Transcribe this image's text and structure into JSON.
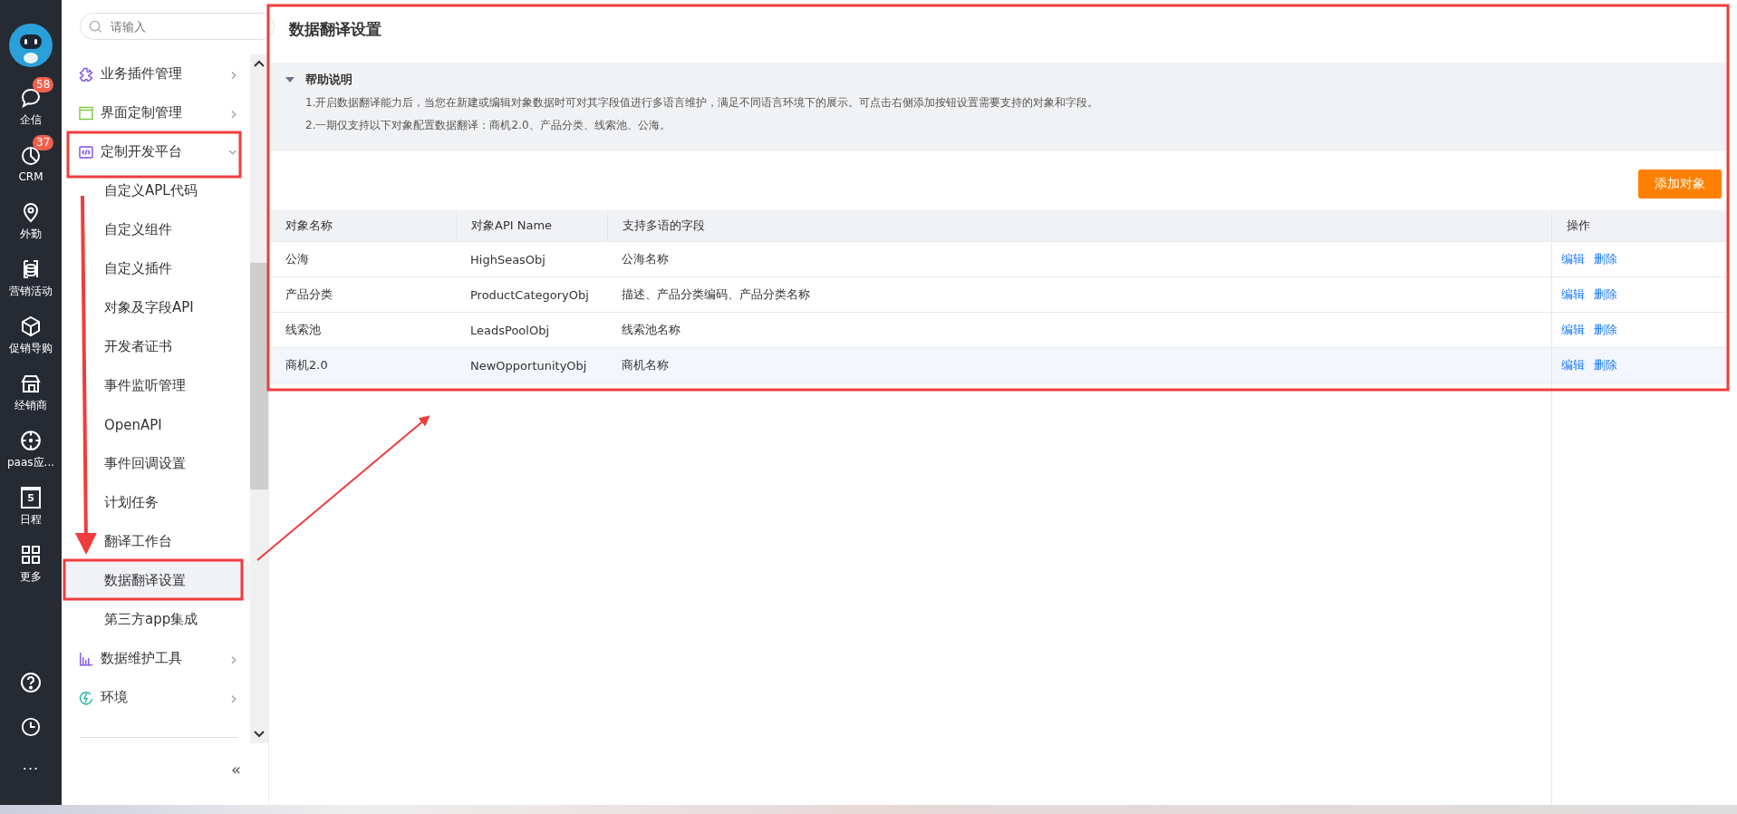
{
  "rail": [
    {
      "label": "企信",
      "badge": "58"
    },
    {
      "label": "CRM",
      "badge": "37"
    },
    {
      "label": "外勤"
    },
    {
      "label": "营销活动"
    },
    {
      "label": "促销导购"
    },
    {
      "label": "经销商"
    },
    {
      "label": "paas应..."
    },
    {
      "label": "日程",
      "icon_text": "5"
    },
    {
      "label": "更多"
    }
  ],
  "rail_bottom_more": "···",
  "sidebar": {
    "search": {
      "placeholder": "请输入"
    },
    "items": [
      {
        "label": "业务插件管理",
        "expanded": false,
        "chevron": "›"
      },
      {
        "label": "界面定制管理",
        "expanded": false,
        "chevron": "›"
      },
      {
        "label": "定制开发平台",
        "expanded": true,
        "chevron": "›",
        "children": [
          {
            "label": "自定义APL代码",
            "selected": false
          },
          {
            "label": "自定义组件",
            "selected": false
          },
          {
            "label": "自定义插件",
            "selected": false
          },
          {
            "label": "对象及字段API",
            "selected": false
          },
          {
            "label": "开发者证书",
            "selected": false
          },
          {
            "label": "事件监听管理",
            "selected": false
          },
          {
            "label": "OpenAPI",
            "selected": false
          },
          {
            "label": "事件回调设置",
            "selected": false
          },
          {
            "label": "计划任务",
            "selected": false
          },
          {
            "label": "翻译工作台",
            "selected": false
          },
          {
            "label": "数据翻译设置",
            "selected": true
          },
          {
            "label": "第三方app集成",
            "selected": false
          }
        ]
      },
      {
        "label": "数据维护工具",
        "expanded": false,
        "chevron": "›"
      },
      {
        "label": "环境",
        "expanded": false,
        "chevron": "›"
      }
    ],
    "collapse": "«"
  },
  "page": {
    "title": "数据翻译设置",
    "help": {
      "title": "帮助说明",
      "expanded": true,
      "lines": [
        "1.开启数据翻译能力后，当您在新建或编辑对象数据时可对其字段值进行多语言维护，满足不同语言环境下的展示。可点击右侧添加按钮设置需要支持的对象和字段。",
        "2.一期仅支持以下对象配置数据翻译：商机2.0、产品分类、线索池、公海。"
      ]
    },
    "add_button": "添加对象",
    "table": {
      "columns": [
        "对象名称",
        "对象API Name",
        "支持多语的字段",
        "操作"
      ],
      "rows": [
        {
          "cells": [
            "公海",
            "HighSeasObj",
            "公海名称"
          ],
          "actions": [
            "编辑",
            "删除"
          ],
          "highlighted": false
        },
        {
          "cells": [
            "产品分类",
            "ProductCategoryObj",
            "描述、产品分类编码、产品分类名称"
          ],
          "actions": [
            "编辑",
            "删除"
          ],
          "highlighted": false
        },
        {
          "cells": [
            "线索池",
            "LeadsPoolObj",
            "线索池名称"
          ],
          "actions": [
            "编辑",
            "删除"
          ],
          "highlighted": false
        },
        {
          "cells": [
            "商机2.0",
            "NewOpportunityObj",
            "商机名称"
          ],
          "actions": [
            "编辑",
            "删除"
          ],
          "highlighted": true
        }
      ]
    }
  }
}
